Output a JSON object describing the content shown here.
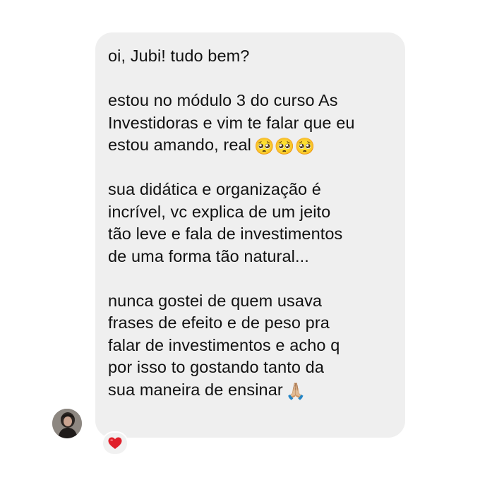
{
  "message": {
    "paragraphs": [
      "oi, Jubi! tudo bem?",
      "estou no módulo 3 do curso As\nInvestidoras e vim te falar que eu\nestou amando, real",
      "sua didática e organização é\nincrível, vc explica de um jeito\ntão leve e fala de investimentos\nde uma forma tão natural...",
      "nunca gostei de quem usava\nfrases de efeito e de peso pra\nfalar de investimentos e acho q\npor isso to gostando tanto da\nsua maneira de ensinar"
    ],
    "emoji_pleading": "🥺🥺🥺",
    "emoji_pray": "🙏🏼"
  },
  "reaction": {
    "icon": "red-heart-icon",
    "color": "#e0202b"
  },
  "avatar": {
    "icon": "profile-photo"
  },
  "colors": {
    "bubble": "#efefef",
    "text": "#111111",
    "background": "#ffffff"
  }
}
